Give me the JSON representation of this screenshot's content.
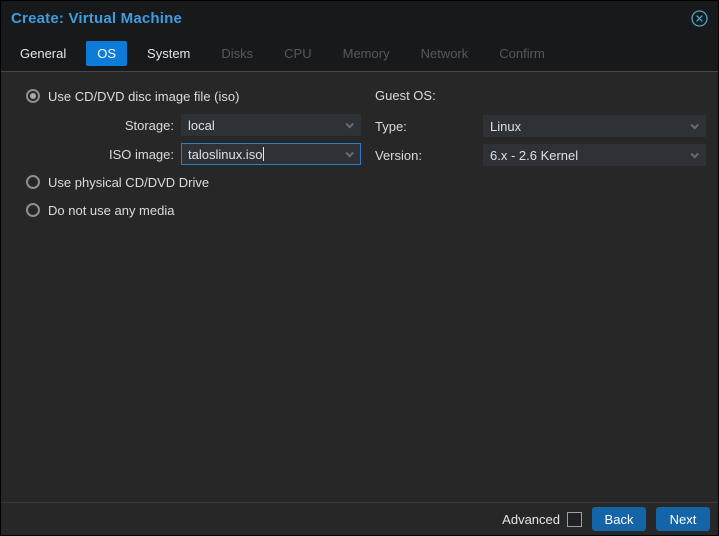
{
  "window": {
    "title": "Create: Virtual Machine",
    "close_icon": "circle-x-icon"
  },
  "tabs": [
    {
      "label": "General",
      "state": "enabled"
    },
    {
      "label": "OS",
      "state": "active"
    },
    {
      "label": "System",
      "state": "enabled"
    },
    {
      "label": "Disks",
      "state": "disabled"
    },
    {
      "label": "CPU",
      "state": "disabled"
    },
    {
      "label": "Memory",
      "state": "disabled"
    },
    {
      "label": "Network",
      "state": "disabled"
    },
    {
      "label": "Confirm",
      "state": "disabled"
    }
  ],
  "form": {
    "left": {
      "radio_iso": {
        "label": "Use CD/DVD disc image file (iso)",
        "selected": true
      },
      "storage": {
        "label": "Storage:",
        "value": "local"
      },
      "iso_image": {
        "label": "ISO image:",
        "value": "taloslinux.iso",
        "focused": true
      },
      "radio_physical": {
        "label": "Use physical CD/DVD Drive",
        "selected": false
      },
      "radio_no_media": {
        "label": "Do not use any media",
        "selected": false
      }
    },
    "right": {
      "guest_os_label": "Guest OS:",
      "type": {
        "label": "Type:",
        "value": "Linux"
      },
      "version": {
        "label": "Version:",
        "value": "6.x - 2.6 Kernel"
      }
    }
  },
  "footer": {
    "advanced_label": "Advanced",
    "advanced_checked": false,
    "back_label": "Back",
    "next_label": "Next"
  },
  "colors": {
    "title_blue": "#3d9de0",
    "active_tab_blue": "#0d7bd8",
    "button_blue": "#1464a8",
    "focus_border": "#2e7cc0",
    "body_bg": "#272727",
    "header_bg": "#17191b",
    "field_bg": "#2e3237",
    "close_icon": "#4aa4c8"
  }
}
